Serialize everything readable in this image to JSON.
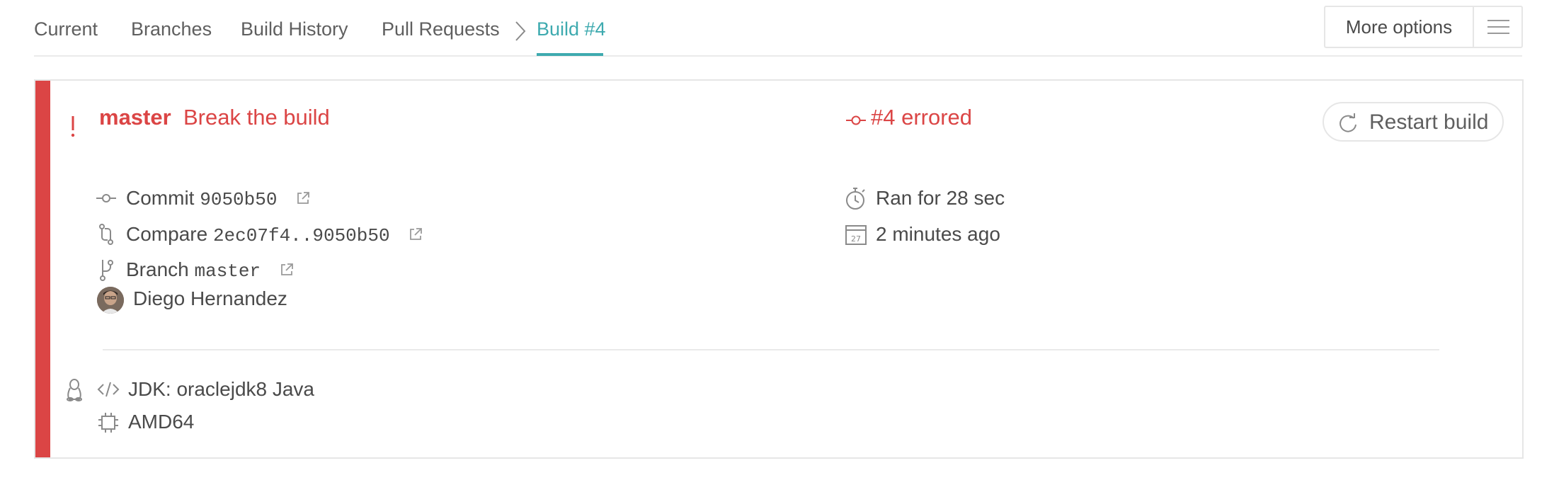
{
  "nav": {
    "tabs": [
      {
        "label": "Current"
      },
      {
        "label": "Branches"
      },
      {
        "label": "Build History"
      },
      {
        "label": "Pull Requests"
      }
    ],
    "active_tab": "Build #4",
    "more_options_label": "More options"
  },
  "build": {
    "branch": "master",
    "message": "Break the build",
    "status": "#4 errored",
    "commit_label": "Commit",
    "commit_sha": "9050b50",
    "compare_label": "Compare",
    "compare_range": "2ec07f4..9050b50",
    "branch_label": "Branch",
    "branch_value": "master",
    "duration": "Ran for 28 sec",
    "finished": "2 minutes ago",
    "calendar_day": "27",
    "author": "Diego Hernandez",
    "restart_label": "Restart build",
    "jdk": "JDK: oraclejdk8 Java",
    "arch": "AMD64"
  },
  "colors": {
    "error": "#db4545",
    "accent": "#3eaaaf",
    "text": "#4a4a4a",
    "border": "#e6e6e6"
  },
  "icons": {
    "status": "error-icon",
    "commit": "commit-icon",
    "compare": "compare-icon",
    "branch": "branch-icon",
    "external": "external-link-icon",
    "duration": "stopwatch-icon",
    "date": "calendar-icon",
    "restart": "restart-icon",
    "os": "linux-icon",
    "language": "code-icon",
    "arch": "cpu-icon",
    "menu": "hamburger-menu-icon"
  }
}
